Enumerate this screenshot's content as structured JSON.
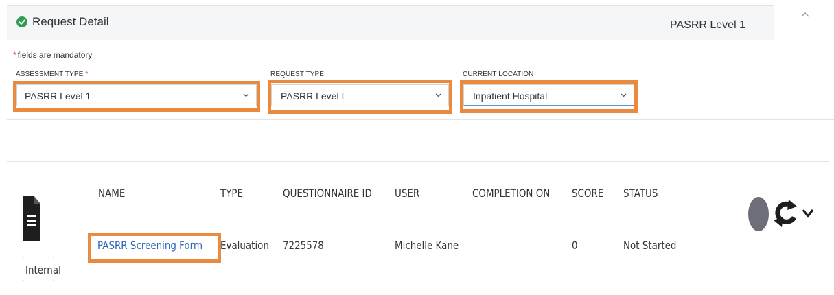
{
  "panel": {
    "title": "Request Detail",
    "right_label": "PASRR Level 1",
    "icons": {
      "status": "check-circle-icon",
      "collapse": "chevron-up-icon"
    }
  },
  "form": {
    "mandatory_star": "*",
    "mandatory_note": "fields are mandatory",
    "assessment_type": {
      "label": "ASSESSMENT TYPE",
      "required_marker": "*",
      "value": "PASRR Level 1"
    },
    "request_type": {
      "label": "REQUEST TYPE",
      "value": "PASRR Level I"
    },
    "current_location": {
      "label": "CURRENT LOCATION",
      "value": "Inpatient Hospital"
    }
  },
  "table": {
    "headers": [
      "NAME",
      "TYPE",
      "QUESTIONNAIRE ID",
      "USER",
      "COMPLETION ON",
      "SCORE",
      "STATUS"
    ],
    "rows": [
      {
        "name": "PASRR Screening Form",
        "type": "Evaluation",
        "questionnaire_id": "7225578",
        "user": "Michelle Kane",
        "completion_on": "",
        "score": "0",
        "status": "Not Started"
      }
    ],
    "badge": "Internal",
    "icons": {
      "document": "document-icon",
      "refresh": "refresh-icon",
      "expand": "chevron-down-icon"
    }
  },
  "colors": {
    "highlight": "#ea8a3e",
    "check": "#2e9e4f",
    "required": "#d9534f",
    "link": "#2c64b5",
    "status_dot": "#6d6e7a"
  }
}
